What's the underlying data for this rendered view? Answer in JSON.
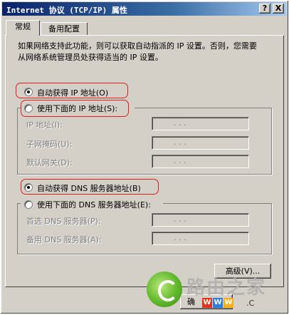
{
  "window": {
    "title": "Internet 协议 (TCP/IP) 属性",
    "help_btn": "?",
    "close_btn": "X"
  },
  "tabs": [
    {
      "label": "常规",
      "active": true
    },
    {
      "label": "备用配置",
      "active": false
    }
  ],
  "description": "如果网络支持此功能，则可以获取自动指派的 IP 设置。否则，您需要从网络系统管理员处获得适当的 IP 设置。",
  "ip": {
    "auto_label": "自动获得 IP 地址(O)",
    "manual_label": "使用下面的 IP 地址(S):",
    "auto_selected": true,
    "fields": [
      {
        "label": "IP 地址(I):",
        "dots": ". . ."
      },
      {
        "label": "子网掩码(U):",
        "dots": ". . ."
      },
      {
        "label": "默认网关(D):",
        "dots": ". . ."
      }
    ]
  },
  "dns": {
    "auto_label": "自动获得 DNS 服务器地址(B)",
    "manual_label": "使用下面的 DNS 服务器地址(E):",
    "auto_selected": true,
    "fields": [
      {
        "label": "首选 DNS 服务器(P):",
        "dots": ". . ."
      },
      {
        "label": "备用 DNS 服务器(A):",
        "dots": ". . ."
      }
    ]
  },
  "buttons": {
    "advanced": "高级(V)...",
    "ok_partial": "确"
  },
  "watermark": {
    "cn": "路由之家",
    "tiles": [
      "W",
      "W",
      "W"
    ],
    "url": ".C"
  },
  "colors": {
    "face": "#d4d0c8",
    "titlebar_start": "#0a246a",
    "titlebar_end": "#a6caf0",
    "highlight": "#d92020"
  }
}
